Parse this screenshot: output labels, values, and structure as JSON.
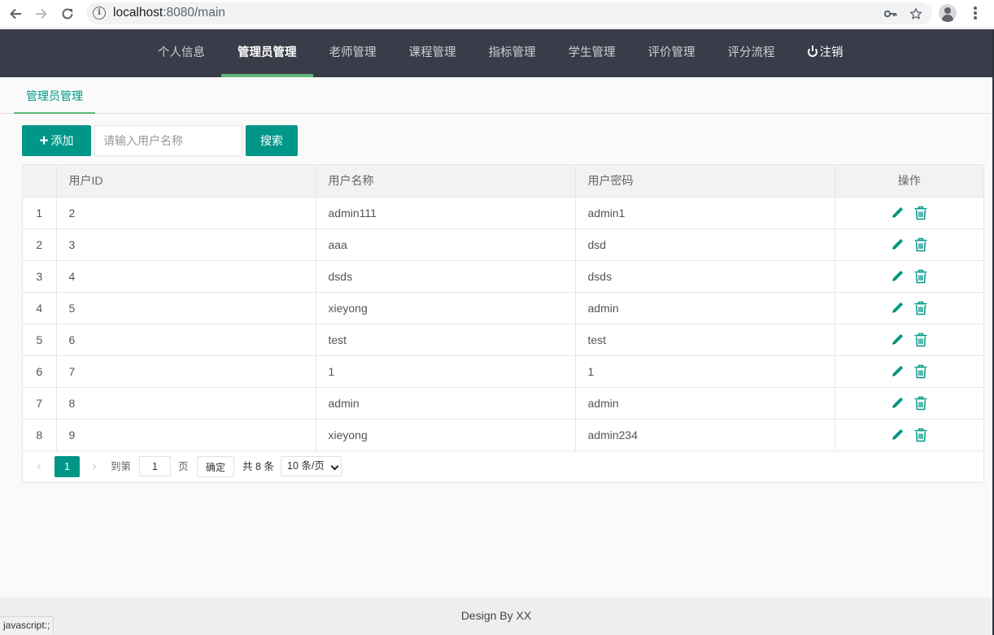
{
  "browser": {
    "url_host": "localhost",
    "url_path": ":8080/main",
    "status_text": "javascript:;"
  },
  "nav": {
    "items": [
      {
        "label": "个人信息",
        "active": false
      },
      {
        "label": "管理员管理",
        "active": true
      },
      {
        "label": "老师管理",
        "active": false
      },
      {
        "label": "课程管理",
        "active": false
      },
      {
        "label": "指标管理",
        "active": false
      },
      {
        "label": "学生管理",
        "active": false
      },
      {
        "label": "评价管理",
        "active": false
      },
      {
        "label": "评分流程",
        "active": false
      }
    ],
    "logout_label": "注销"
  },
  "tab": {
    "label": "管理员管理"
  },
  "toolbar": {
    "add_label": "添加",
    "search_placeholder": "请输入用户名称",
    "search_value": "",
    "search_label": "搜索"
  },
  "table": {
    "columns": [
      "",
      "用户ID",
      "用户名称",
      "用户密码",
      "操作"
    ],
    "rows": [
      {
        "num": "1",
        "id": "2",
        "name": "admin111",
        "password": "admin1"
      },
      {
        "num": "2",
        "id": "3",
        "name": "aaa",
        "password": "dsd"
      },
      {
        "num": "3",
        "id": "4",
        "name": "dsds",
        "password": "dsds"
      },
      {
        "num": "4",
        "id": "5",
        "name": "xieyong",
        "password": "admin"
      },
      {
        "num": "5",
        "id": "6",
        "name": "test",
        "password": "test"
      },
      {
        "num": "6",
        "id": "7",
        "name": "1",
        "password": "1"
      },
      {
        "num": "7",
        "id": "8",
        "name": "admin",
        "password": "admin"
      },
      {
        "num": "8",
        "id": "9",
        "name": "xieyong",
        "password": "admin234"
      }
    ]
  },
  "pager": {
    "current_page": "1",
    "goto_label": "到第",
    "goto_value": "1",
    "page_unit": "页",
    "confirm_label": "确定",
    "total_text": "共 8 条",
    "page_size": "10 条/页"
  },
  "footer": {
    "text": "Design By XX"
  },
  "colors": {
    "accent": "#009688",
    "nav_bg": "#393d49",
    "nav_indicator": "#5fb878"
  }
}
